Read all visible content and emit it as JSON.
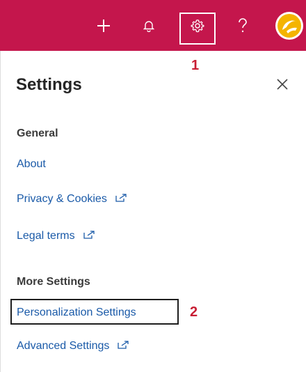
{
  "topbar": {
    "icons": [
      "add-icon",
      "bell-icon",
      "gear-icon",
      "help-icon",
      "avatar"
    ],
    "bg_color": "#c4164c"
  },
  "callouts": {
    "one": "1",
    "two": "2"
  },
  "panel": {
    "title": "Settings",
    "sections": {
      "general": {
        "heading": "General",
        "links": [
          "About",
          "Privacy & Cookies",
          "Legal terms"
        ]
      },
      "more": {
        "heading": "More Settings",
        "links": [
          "Personalization Settings",
          "Advanced Settings"
        ]
      }
    }
  },
  "colors": {
    "accent": "#c4164c",
    "link": "#1a5aa8",
    "callout": "#c81e34"
  }
}
